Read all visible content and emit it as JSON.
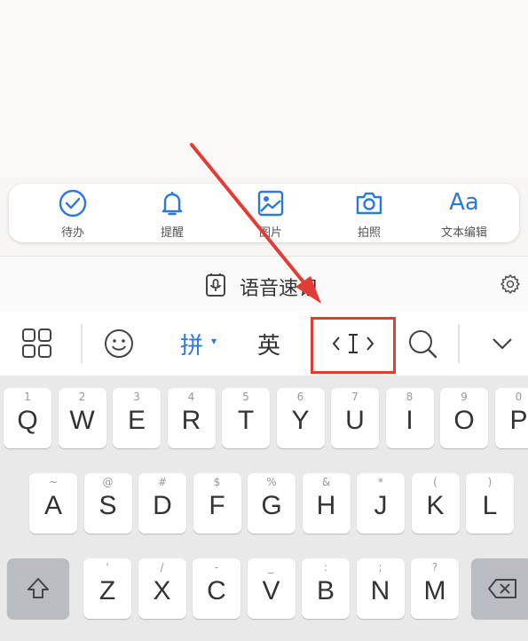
{
  "toolbar": {
    "items": [
      {
        "label": "待办",
        "icon": "checkmark-circle-icon"
      },
      {
        "label": "提醒",
        "icon": "bell-icon"
      },
      {
        "label": "图片",
        "icon": "image-icon"
      },
      {
        "label": "拍照",
        "icon": "camera-icon"
      },
      {
        "label": "文本编辑",
        "icon": "text-aa-icon",
        "glyph": "Aa"
      }
    ]
  },
  "voice": {
    "label": "语音速记",
    "icon": "microphone-note-icon"
  },
  "candidate_bar": {
    "pinyin_label": "拼",
    "english_label": "英",
    "cursor_glyph": "‹I›"
  },
  "keyboard": {
    "row1": [
      {
        "main": "Q",
        "sub": "1"
      },
      {
        "main": "W",
        "sub": "2"
      },
      {
        "main": "E",
        "sub": "3"
      },
      {
        "main": "R",
        "sub": "4"
      },
      {
        "main": "T",
        "sub": "5"
      },
      {
        "main": "Y",
        "sub": "6"
      },
      {
        "main": "U",
        "sub": "7"
      },
      {
        "main": "I",
        "sub": "8"
      },
      {
        "main": "O",
        "sub": "9"
      },
      {
        "main": "P",
        "sub": "0"
      }
    ],
    "row2": [
      {
        "main": "A",
        "sub": "~"
      },
      {
        "main": "S",
        "sub": "@"
      },
      {
        "main": "D",
        "sub": "#"
      },
      {
        "main": "F",
        "sub": "$"
      },
      {
        "main": "G",
        "sub": "%"
      },
      {
        "main": "H",
        "sub": "&"
      },
      {
        "main": "J",
        "sub": "*"
      },
      {
        "main": "K",
        "sub": "("
      },
      {
        "main": "L",
        "sub": ")"
      }
    ],
    "row3": [
      {
        "main": "Z",
        "sub": "'"
      },
      {
        "main": "X",
        "sub": "/"
      },
      {
        "main": "C",
        "sub": "-"
      },
      {
        "main": "V",
        "sub": "_"
      },
      {
        "main": "B",
        "sub": ":"
      },
      {
        "main": "N",
        "sub": ";"
      },
      {
        "main": "M",
        "sub": "?"
      }
    ]
  },
  "colors": {
    "accent": "#2d78d8",
    "highlight": "#e33b35"
  }
}
